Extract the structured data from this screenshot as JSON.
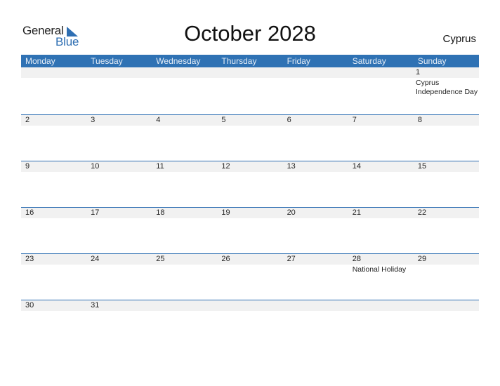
{
  "logo": {
    "general": "General",
    "blue": "Blue"
  },
  "header": {
    "title": "October 2028",
    "country": "Cyprus"
  },
  "weekdays": [
    "Monday",
    "Tuesday",
    "Wednesday",
    "Thursday",
    "Friday",
    "Saturday",
    "Sunday"
  ],
  "weeks": [
    [
      {
        "d": ""
      },
      {
        "d": ""
      },
      {
        "d": ""
      },
      {
        "d": ""
      },
      {
        "d": ""
      },
      {
        "d": ""
      },
      {
        "d": "1",
        "e": "Cyprus Independence Day"
      }
    ],
    [
      {
        "d": "2"
      },
      {
        "d": "3"
      },
      {
        "d": "4"
      },
      {
        "d": "5"
      },
      {
        "d": "6"
      },
      {
        "d": "7"
      },
      {
        "d": "8"
      }
    ],
    [
      {
        "d": "9"
      },
      {
        "d": "10"
      },
      {
        "d": "11"
      },
      {
        "d": "12"
      },
      {
        "d": "13"
      },
      {
        "d": "14"
      },
      {
        "d": "15"
      }
    ],
    [
      {
        "d": "16"
      },
      {
        "d": "17"
      },
      {
        "d": "18"
      },
      {
        "d": "19"
      },
      {
        "d": "20"
      },
      {
        "d": "21"
      },
      {
        "d": "22"
      }
    ],
    [
      {
        "d": "23"
      },
      {
        "d": "24"
      },
      {
        "d": "25"
      },
      {
        "d": "26"
      },
      {
        "d": "27"
      },
      {
        "d": "28",
        "e": "National Holiday"
      },
      {
        "d": "29"
      }
    ],
    [
      {
        "d": "30"
      },
      {
        "d": "31"
      },
      {
        "d": ""
      },
      {
        "d": ""
      },
      {
        "d": ""
      },
      {
        "d": ""
      },
      {
        "d": ""
      }
    ]
  ],
  "colors": {
    "accent": "#2f72b4",
    "day_bar": "#f1f1f1"
  }
}
